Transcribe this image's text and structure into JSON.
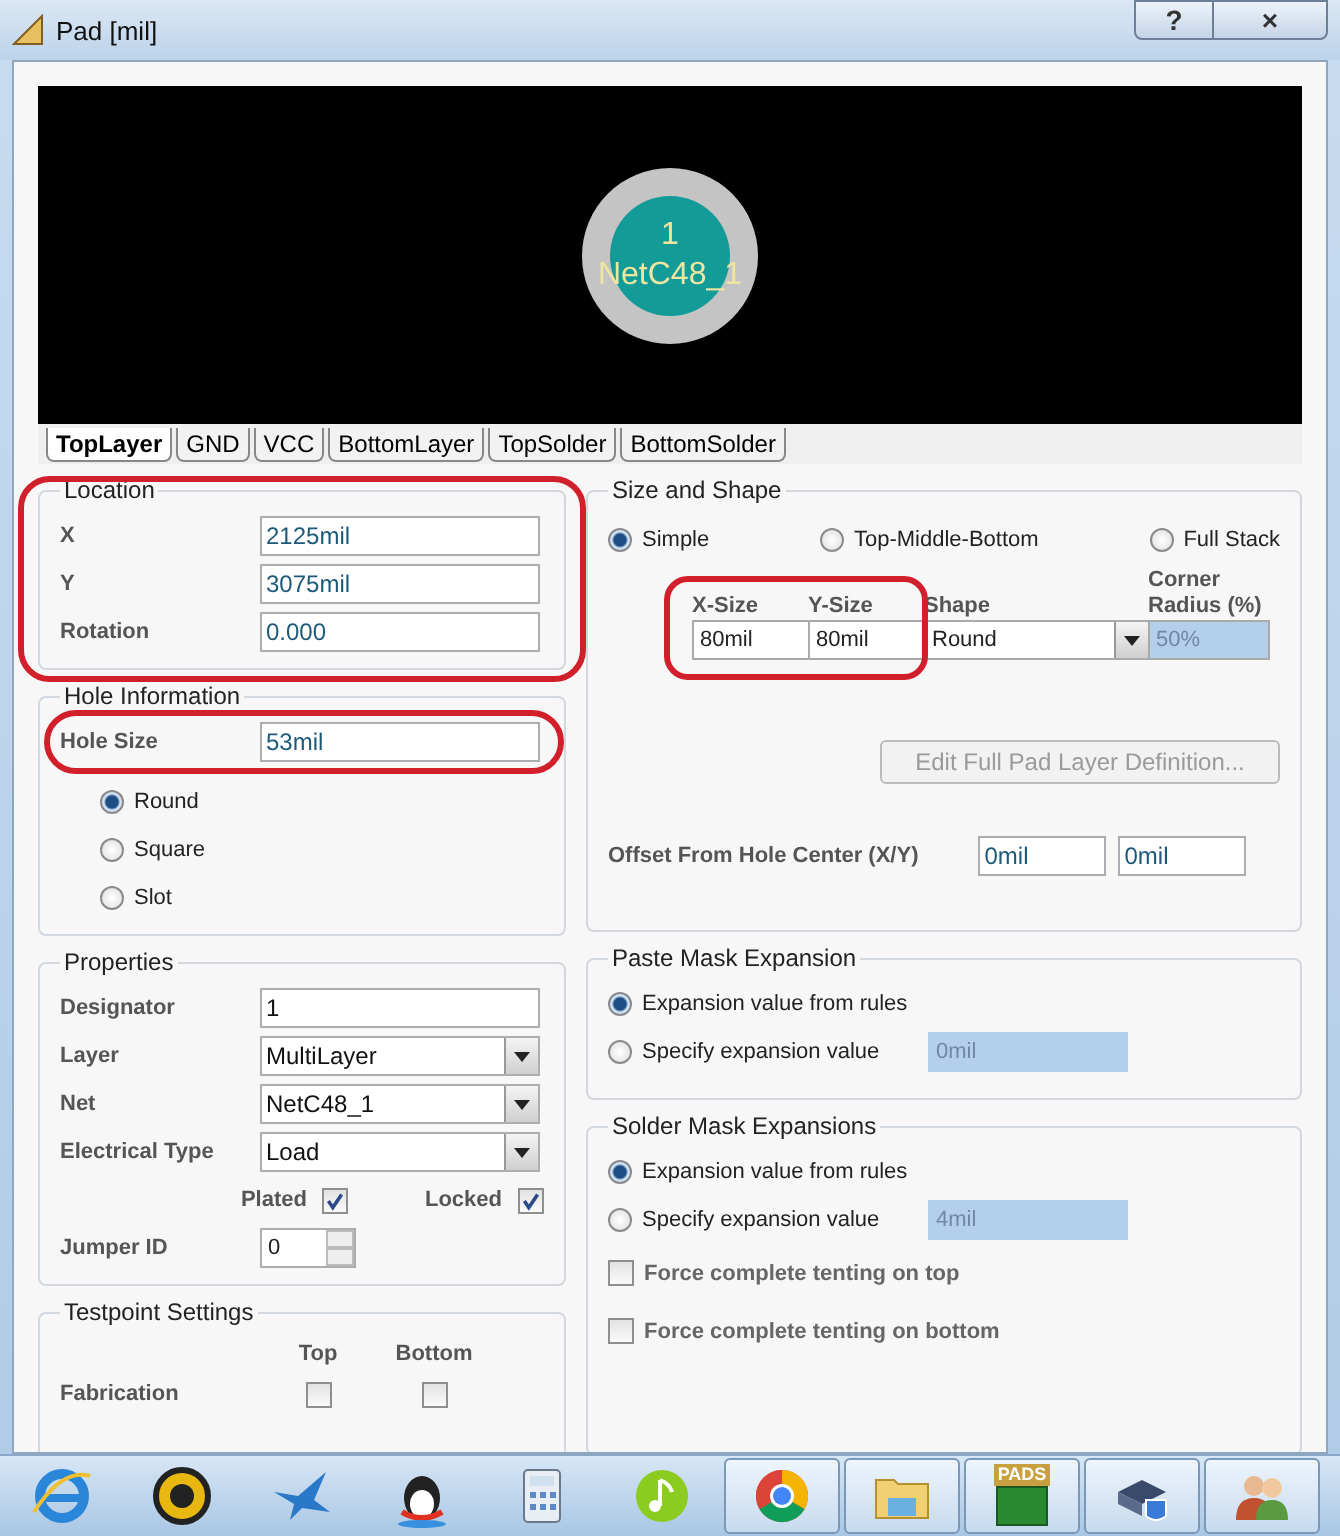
{
  "window": {
    "title": "Pad [mil]",
    "help_button": "?",
    "close_button": "×"
  },
  "preview": {
    "designator": "1",
    "net": "NetC48_1"
  },
  "layer_tabs": [
    {
      "label": "TopLayer",
      "selected": true
    },
    {
      "label": "GND",
      "selected": false
    },
    {
      "label": "VCC",
      "selected": false
    },
    {
      "label": "BottomLayer",
      "selected": false
    },
    {
      "label": "TopSolder",
      "selected": false
    },
    {
      "label": "BottomSolder",
      "selected": false
    }
  ],
  "location": {
    "title": "Location",
    "fields": [
      {
        "label": "X",
        "value": "2125mil"
      },
      {
        "label": "Y",
        "value": "3075mil"
      },
      {
        "label": "Rotation",
        "value": "0.000"
      }
    ]
  },
  "hole_information": {
    "title": "Hole Information",
    "hole_size_label": "Hole Size",
    "hole_size": "53mil",
    "shapes": [
      {
        "label": "Round",
        "selected": true
      },
      {
        "label": "Square",
        "selected": false
      },
      {
        "label": "Slot",
        "selected": false
      }
    ]
  },
  "properties": {
    "title": "Properties",
    "rows": [
      {
        "kind": "text",
        "label": "Designator",
        "value": "1"
      },
      {
        "kind": "dropdown",
        "label": "Layer",
        "value": "MultiLayer"
      },
      {
        "kind": "dropdown",
        "label": "Net",
        "value": "NetC48_1"
      },
      {
        "kind": "dropdown",
        "label": "Electrical Type",
        "value": "Load"
      }
    ],
    "checks": [
      {
        "label": "Plated",
        "checked": true
      },
      {
        "label": "Locked",
        "checked": true
      }
    ],
    "jumper_id": {
      "label": "Jumper ID",
      "value": "0"
    }
  },
  "testpoint": {
    "title": "Testpoint Settings",
    "columns": [
      "Top",
      "Bottom"
    ],
    "rows": [
      {
        "label": "Fabrication",
        "top": false,
        "bottom": false
      }
    ]
  },
  "size_and_shape": {
    "title": "Size and Shape",
    "modes": [
      {
        "label": "Simple",
        "selected": true
      },
      {
        "label": "Top-Middle-Bottom",
        "selected": false
      },
      {
        "label": "Full Stack",
        "selected": false
      }
    ],
    "headers": [
      "X-Size",
      "Y-Size",
      "Shape",
      "Corner Radius (%)"
    ],
    "x_size": "80mil",
    "y_size": "80mil",
    "shape": "Round",
    "corner_radius": "50%",
    "edit_button": {
      "label": "Edit Full Pad Layer Definition...",
      "disabled": true
    },
    "offset_label": "Offset From Hole Center (X/Y)",
    "offset_x": "0mil",
    "offset_y": "0mil"
  },
  "paste_mask": {
    "title": "Paste Mask Expansion",
    "options": [
      {
        "label": "Expansion value from rules",
        "selected": true
      },
      {
        "label": "Specify expansion value",
        "selected": false
      }
    ],
    "value": "0mil"
  },
  "solder_mask": {
    "title": "Solder Mask Expansions",
    "options": [
      {
        "label": "Expansion value from rules",
        "selected": true
      },
      {
        "label": "Specify expansion value",
        "selected": false
      }
    ],
    "value": "4mil",
    "tenting": [
      {
        "label": "Force complete tenting on top",
        "checked": false
      },
      {
        "label": "Force complete tenting on bottom",
        "checked": false
      }
    ]
  },
  "taskbar": [
    {
      "kind": "browser",
      "open": false
    },
    {
      "kind": "editor",
      "open": false
    },
    {
      "kind": "bird",
      "open": false
    },
    {
      "kind": "penguin",
      "open": false
    },
    {
      "kind": "calculator",
      "open": false
    },
    {
      "kind": "music",
      "open": false
    },
    {
      "kind": "chrome",
      "open": true
    },
    {
      "kind": "folder",
      "open": true
    },
    {
      "kind": "pads",
      "open": true,
      "label": "PADS"
    },
    {
      "kind": "installer",
      "open": true
    },
    {
      "kind": "users",
      "open": true
    }
  ]
}
